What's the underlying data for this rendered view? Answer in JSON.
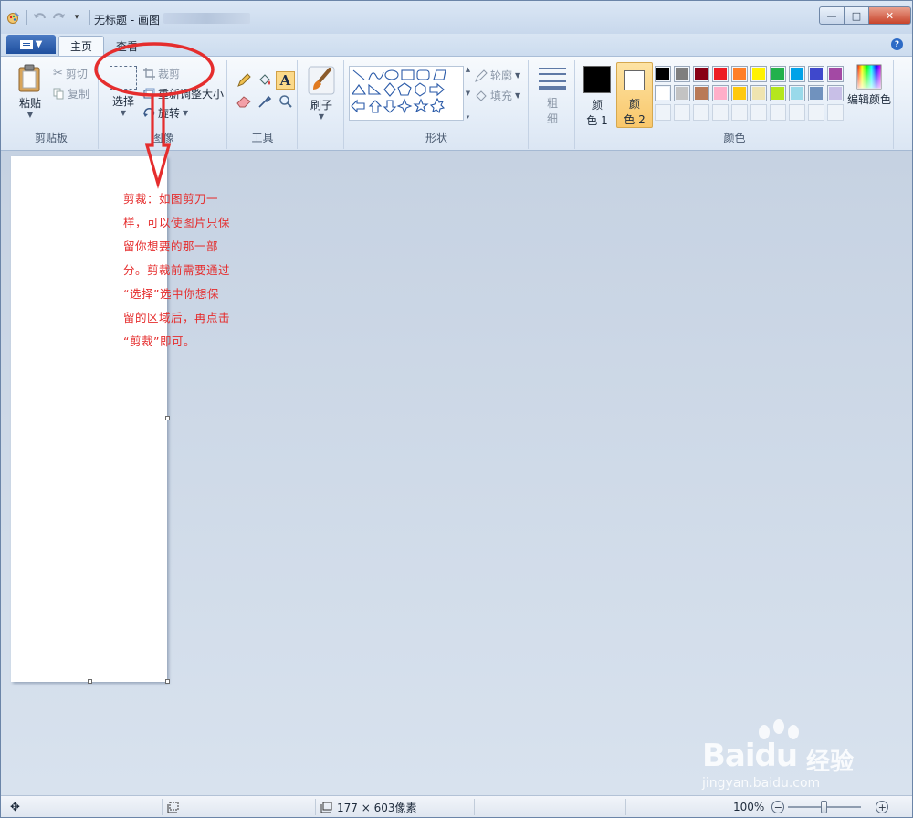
{
  "window": {
    "title": "无标题 - 画图",
    "controls": {
      "minimize": "—",
      "maximize": "□",
      "close": "✕"
    }
  },
  "tabs": {
    "home": "主页",
    "view": "查看"
  },
  "ribbon": {
    "clipboard": {
      "label": "剪贴板",
      "paste": "粘贴",
      "cut": "剪切",
      "copy": "复制"
    },
    "image": {
      "label": "图像",
      "select": "选择",
      "crop": "裁剪",
      "resize": "重新调整大小",
      "rotate": "旋转"
    },
    "tools": {
      "label": "工具"
    },
    "brushes": {
      "label": "刷子"
    },
    "shapes": {
      "label": "形状",
      "outline": "轮廓",
      "fill": "填充"
    },
    "size": {
      "label_top": "粗",
      "label_bottom": "细"
    },
    "colors": {
      "label": "颜色",
      "color1": {
        "top": "颜",
        "bottom": "色 1",
        "value": "#000000"
      },
      "color2": {
        "top": "颜",
        "bottom": "色 2",
        "value": "#ffffff"
      },
      "edit": "编辑颜色",
      "palette_row1": [
        "#000000",
        "#7f7f7f",
        "#880015",
        "#ed1c24",
        "#ff7f27",
        "#fff200",
        "#22b14c",
        "#00a2e8",
        "#3f48cc",
        "#a349a4"
      ],
      "palette_row2": [
        "#ffffff",
        "#c3c3c3",
        "#b97a57",
        "#ffaec9",
        "#ffc90e",
        "#efe4b0",
        "#b5e61d",
        "#99d9ea",
        "#7092be",
        "#c8bfe7"
      ]
    }
  },
  "annotation": {
    "lines": [
      "剪裁：如图剪刀一",
      "样，可以使图片只保",
      "留你想要的那一部",
      "分。剪裁前需要通过",
      "“选择”选中你想保",
      "留的区域后，再点击",
      "“剪裁”即可。"
    ]
  },
  "status": {
    "dimensions": "177 × 603像素",
    "zoom": "100%",
    "zoom_level": 0.5
  },
  "watermark": {
    "brand": "Bai",
    "brand2": "du",
    "jingyan": "经验",
    "url": "jingyan.baidu.com"
  }
}
